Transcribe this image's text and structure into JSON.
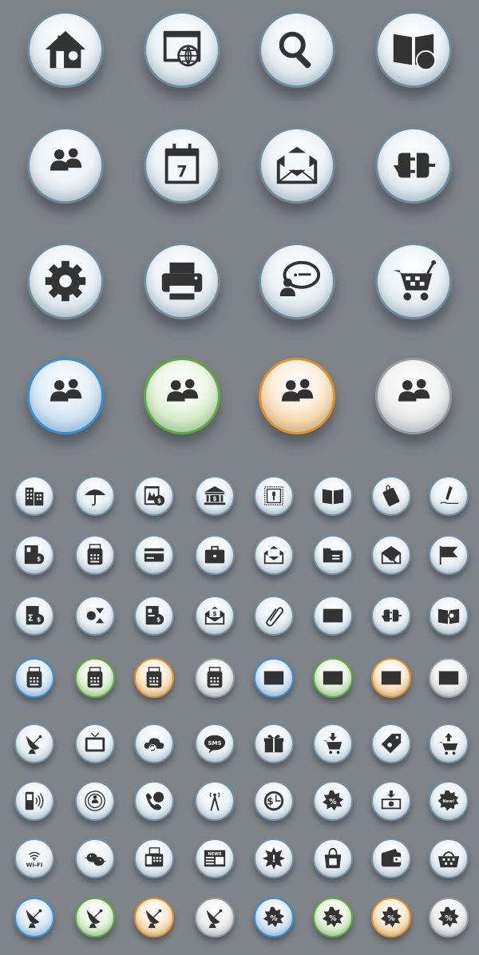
{
  "icon_sheet": {
    "large_rows": [
      [
        {
          "icon": "home-icon",
          "theme": "default"
        },
        {
          "icon": "web-browser-globe-icon",
          "theme": "default"
        },
        {
          "icon": "search-magnifier-icon",
          "theme": "default"
        },
        {
          "icon": "book-clock-icon",
          "theme": "default"
        }
      ],
      [
        {
          "icon": "users-icon",
          "theme": "default"
        },
        {
          "icon": "calendar-icon",
          "theme": "default",
          "text": "7"
        },
        {
          "icon": "open-envelope-icon",
          "theme": "default"
        },
        {
          "icon": "plug-connector-icon",
          "theme": "default"
        }
      ],
      [
        {
          "icon": "gear-icon",
          "theme": "default"
        },
        {
          "icon": "printer-icon",
          "theme": "default"
        },
        {
          "icon": "chat-user-icon",
          "theme": "default"
        },
        {
          "icon": "shopping-cart-icon",
          "theme": "default"
        }
      ],
      [
        {
          "icon": "users-icon",
          "theme": "blue"
        },
        {
          "icon": "users-icon",
          "theme": "green"
        },
        {
          "icon": "users-icon",
          "theme": "orange"
        },
        {
          "icon": "users-icon",
          "theme": "gray"
        }
      ]
    ],
    "small_rows": [
      [
        {
          "icon": "buildings-icon",
          "theme": "default"
        },
        {
          "icon": "umbrella-icon",
          "theme": "default"
        },
        {
          "icon": "money-bag-document-icon",
          "theme": "default"
        },
        {
          "icon": "bank-icon",
          "theme": "default"
        },
        {
          "icon": "postage-stamp-icon",
          "theme": "default"
        },
        {
          "icon": "open-book-icon",
          "theme": "default"
        },
        {
          "icon": "document-clip-icon",
          "theme": "default"
        },
        {
          "icon": "pen-signature-icon",
          "theme": "default"
        }
      ],
      [
        {
          "icon": "money-bag-id-icon",
          "theme": "default"
        },
        {
          "icon": "pos-terminal-icon",
          "theme": "default"
        },
        {
          "icon": "credit-card-icon",
          "theme": "default"
        },
        {
          "icon": "briefcase-icon",
          "theme": "default"
        },
        {
          "icon": "open-mail-icon",
          "theme": "default"
        },
        {
          "icon": "folder-icon",
          "theme": "default"
        },
        {
          "icon": "mail-search-icon",
          "theme": "default"
        },
        {
          "icon": "flag-icon",
          "theme": "default"
        }
      ],
      [
        {
          "icon": "sum-dollar-document-icon",
          "theme": "default"
        },
        {
          "icon": "calculator-arrows-icon",
          "theme": "default"
        },
        {
          "icon": "dollar-invoice-icon",
          "theme": "default"
        },
        {
          "icon": "dollar-mail-icon",
          "theme": "default"
        },
        {
          "icon": "paperclip-icon",
          "theme": "default"
        },
        {
          "icon": "envelope-icon",
          "theme": "default"
        },
        {
          "icon": "plug-connector-icon",
          "theme": "default"
        },
        {
          "icon": "book-search-icon",
          "theme": "default"
        }
      ],
      [
        {
          "icon": "pos-terminal-icon",
          "theme": "blue"
        },
        {
          "icon": "pos-terminal-icon",
          "theme": "green"
        },
        {
          "icon": "pos-terminal-icon",
          "theme": "orange"
        },
        {
          "icon": "pos-terminal-icon",
          "theme": "gray"
        },
        {
          "icon": "envelope-icon",
          "theme": "blue"
        },
        {
          "icon": "envelope-icon",
          "theme": "green"
        },
        {
          "icon": "envelope-icon",
          "theme": "orange"
        },
        {
          "icon": "envelope-icon",
          "theme": "gray"
        }
      ],
      [
        {
          "icon": "satellite-dish-icon",
          "theme": "default"
        },
        {
          "icon": "tv-icon",
          "theme": "default"
        },
        {
          "icon": "cloud-sync-icon",
          "theme": "default"
        },
        {
          "icon": "sms-bubble-icon",
          "theme": "default",
          "text": "SMS"
        },
        {
          "icon": "gift-box-icon",
          "theme": "default"
        },
        {
          "icon": "cart-download-icon",
          "theme": "default"
        },
        {
          "icon": "price-tag-icon",
          "theme": "default"
        },
        {
          "icon": "cart-upload-icon",
          "theme": "default"
        }
      ],
      [
        {
          "icon": "mobile-signal-icon",
          "theme": "default"
        },
        {
          "icon": "broadcast-user-icon",
          "theme": "default"
        },
        {
          "icon": "phone-globe-icon",
          "theme": "default"
        },
        {
          "icon": "antenna-tower-icon",
          "theme": "default"
        },
        {
          "icon": "dollar-clock-icon",
          "theme": "default"
        },
        {
          "icon": "discount-badge-icon",
          "theme": "default",
          "text": "%"
        },
        {
          "icon": "cash-download-icon",
          "theme": "default"
        },
        {
          "icon": "new-badge-icon",
          "theme": "default",
          "text": "New!"
        }
      ],
      [
        {
          "icon": "wifi-icon",
          "theme": "default",
          "text": "WI-FI"
        },
        {
          "icon": "birds-icon",
          "theme": "default"
        },
        {
          "icon": "fax-machine-icon",
          "theme": "default"
        },
        {
          "icon": "newspaper-icon",
          "theme": "default",
          "text": "NEWS"
        },
        {
          "icon": "alert-burst-icon",
          "theme": "default",
          "text": "!"
        },
        {
          "icon": "shopping-bag-icon",
          "theme": "default"
        },
        {
          "icon": "wallet-icon",
          "theme": "default"
        },
        {
          "icon": "shopping-basket-icon",
          "theme": "default"
        }
      ],
      [
        {
          "icon": "satellite-dish-icon",
          "theme": "blue"
        },
        {
          "icon": "satellite-dish-icon",
          "theme": "green"
        },
        {
          "icon": "satellite-dish-icon",
          "theme": "orange"
        },
        {
          "icon": "satellite-dish-icon",
          "theme": "gray"
        },
        {
          "icon": "discount-badge-icon",
          "theme": "blue",
          "text": "%"
        },
        {
          "icon": "discount-badge-icon",
          "theme": "green",
          "text": "%"
        },
        {
          "icon": "discount-badge-icon",
          "theme": "orange",
          "text": "%"
        },
        {
          "icon": "discount-badge-icon",
          "theme": "gray",
          "text": "%"
        }
      ]
    ],
    "colors": {
      "background": "#7f8489",
      "glyph": "#333333",
      "ring_default": "#6f8a98",
      "ring_blue": "#3a8fd0",
      "ring_green": "#5cac3a",
      "ring_orange": "#e0902a",
      "ring_gray": "#9a9a9a"
    }
  }
}
